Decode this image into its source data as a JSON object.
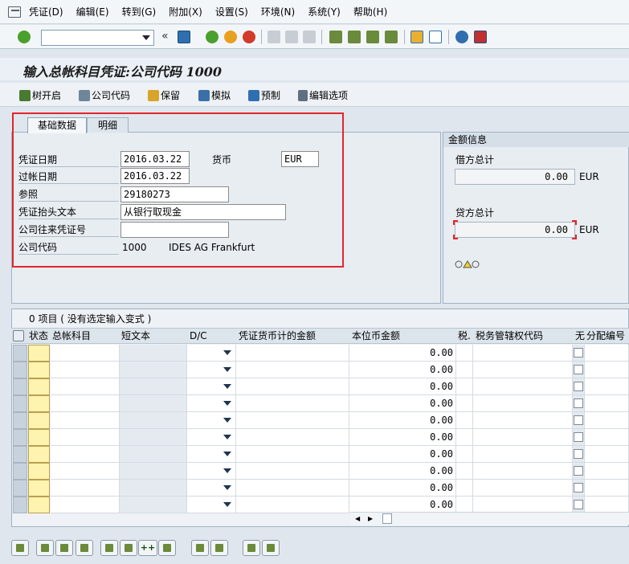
{
  "menu": [
    "凭证(D)",
    "编辑(E)",
    "转到(G)",
    "附加(X)",
    "设置(S)",
    "环境(N)",
    "系统(Y)",
    "帮助(H)"
  ],
  "title": "输入总帐科目凭证:公司代码 1000",
  "app_toolbar": [
    "树开启",
    "公司代码",
    "保留",
    "模拟",
    "预制",
    "编辑选项"
  ],
  "tabs": [
    "基础数据",
    "明细"
  ],
  "header": {
    "doc_date_label": "凭证日期",
    "doc_date": "2016.03.22",
    "currency_label": "货币",
    "currency": "EUR",
    "post_date_label": "过帐日期",
    "post_date": "2016.03.22",
    "reference_label": "参照",
    "reference": "29180273",
    "header_text_label": "凭证抬头文本",
    "header_text": "从银行取现金",
    "intercompany_label": "公司往来凭证号",
    "intercompany": "",
    "company_label": "公司代码",
    "company_code": "1000",
    "company_name": "IDES AG Frankfurt"
  },
  "amount_info": {
    "title": "金额信息",
    "debit_label": "借方总计",
    "debit_value": "0.00",
    "debit_cur": "EUR",
    "credit_label": "贷方总计",
    "credit_value": "0.00",
    "credit_cur": "EUR"
  },
  "table": {
    "title": "0 项目 ( 没有选定输入变式 )",
    "columns": [
      "状态",
      "总帐科目",
      "短文本",
      "D/C",
      "凭证货币计的金额",
      "本位币金额",
      "税.",
      "税务管辖权代码",
      "无",
      "分配编号"
    ],
    "rows": [
      "0.00",
      "0.00",
      "0.00",
      "0.00",
      "0.00",
      "0.00",
      "0.00",
      "0.00",
      "0.00",
      "0.00"
    ]
  }
}
